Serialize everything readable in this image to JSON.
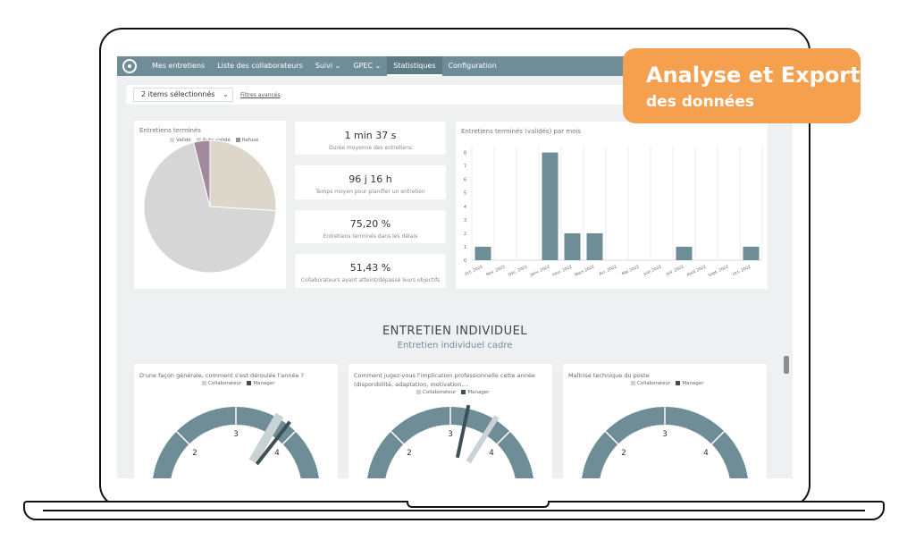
{
  "nav": {
    "items": [
      {
        "label": "Mes entretiens"
      },
      {
        "label": "Liste des collaborateurs"
      },
      {
        "label": "Suivi ⌄"
      },
      {
        "label": "GPEC ⌄"
      },
      {
        "label": "Statistiques"
      },
      {
        "label": "Configuration"
      }
    ],
    "active_index": 4
  },
  "filter": {
    "selected": "2 items sélectionnés",
    "advanced": "Filtres avancés"
  },
  "pie_card": {
    "title": "Entretiens terminés",
    "legend": [
      "Validé",
      "Auto-validé",
      "Refusé"
    ],
    "colors": [
      "#ddd6cb",
      "#d6d6d6",
      "#a3899e"
    ]
  },
  "kpis": [
    {
      "value": "1 min 37 s",
      "label": "Durée moyenne des entretiens"
    },
    {
      "value": "96 j 16 h",
      "label": "Temps moyen pour planifier un entretien"
    },
    {
      "value": "75,20 %",
      "label": "Entretiens terminés dans les délais"
    },
    {
      "value": "51,43 %",
      "label": "Collaborateurs ayant atteint/dépassé leurs objectifs"
    }
  ],
  "bar_card": {
    "title": "Entretiens terminés (validés) par mois"
  },
  "chart_data": [
    {
      "type": "pie",
      "title": "Entretiens terminés",
      "categories": [
        "Validé",
        "Auto-validé",
        "Refusé"
      ],
      "values": [
        26,
        70,
        4
      ]
    },
    {
      "type": "bar",
      "title": "Entretiens terminés (validés) par mois",
      "categories": [
        "Oct. 2021",
        "Nov. 2021",
        "Déc. 2021",
        "Janv. 2022",
        "Févr. 2022",
        "Mars 2022",
        "Avr. 2022",
        "Mai 2022",
        "Juin 2022",
        "Juil. 2022",
        "Août 2022",
        "Sept. 2022",
        "Oct. 2022"
      ],
      "values": [
        1,
        0,
        0,
        8,
        2,
        2,
        0,
        0,
        0,
        1,
        0,
        0,
        1
      ],
      "yticks": [
        0,
        1,
        2,
        3,
        4,
        5,
        6,
        7,
        8
      ],
      "ylim": [
        0,
        8.5
      ],
      "color": "#6f8d97"
    }
  ],
  "section": {
    "title": "ENTRETIEN INDIVIDUEL",
    "subtitle": "Entretien individuel cadre"
  },
  "questions": [
    {
      "title": "D'une façon générale, comment s'est déroulée l'année ?",
      "legend": [
        "Collaborateur",
        "Manager"
      ]
    },
    {
      "title": "Comment jugez-vous l'implication professionnelle cette année (disponibilité, adaptation, motivation,...",
      "legend": [
        "Collaborateur",
        "Manager"
      ]
    },
    {
      "title": "Maîtrise technique du poste",
      "legend": [
        "Collaborateur",
        "Manager"
      ]
    }
  ],
  "gauge_labels": [
    "2",
    "3",
    "4"
  ],
  "badge": {
    "line1": "Analyse et Export",
    "line2": "des données"
  }
}
